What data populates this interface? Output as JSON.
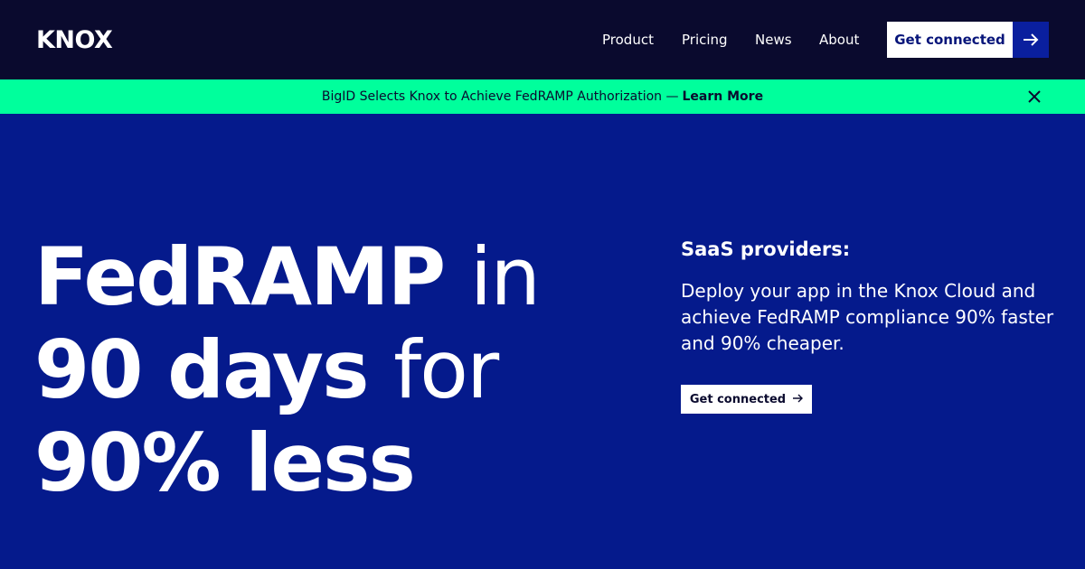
{
  "brand": {
    "logo_text": "KNOX"
  },
  "nav": {
    "links": [
      "Product",
      "Pricing",
      "News",
      "About"
    ],
    "cta_label": "Get connected"
  },
  "banner": {
    "text": "BigID Selects Knox to Achieve FedRAMP Authorization —",
    "link": "Learn More"
  },
  "hero": {
    "line1_bold": "FedRAMP",
    "line1_light": "in",
    "line2_bold": "90 days",
    "line2_light": "for",
    "line3_bold": "90% less"
  },
  "side": {
    "heading": "SaaS providers:",
    "body": "Deploy your app in the Knox Cloud and achieve FedRAMP compliance 90% faster and 90% cheaper.",
    "cta_label": "Get connected"
  },
  "colors": {
    "nav_bg": "#0a0a2e",
    "hero_bg": "#051a8c",
    "banner_bg": "#00ff9c",
    "accent_button": "#0a1f9e"
  },
  "icons": {
    "nav_cta_icon": "arrow-right-icon",
    "banner_close_icon": "close-icon",
    "side_cta_icon": "arrow-right-icon"
  }
}
